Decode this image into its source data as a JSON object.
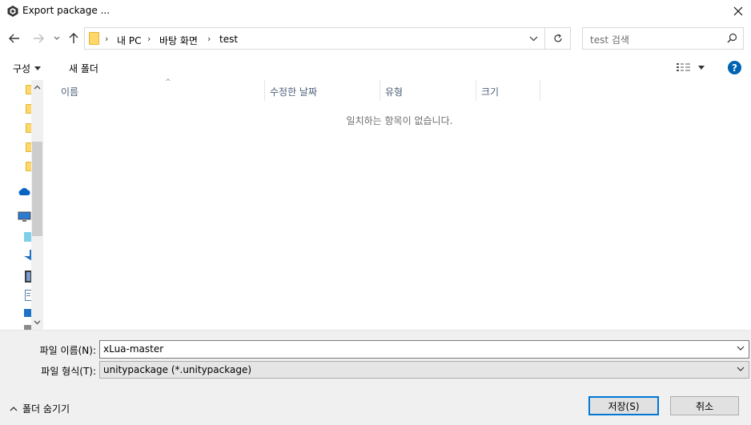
{
  "window": {
    "title": "Export package ..."
  },
  "address": {
    "crumbs": [
      "내 PC",
      "바탕 화면",
      "test"
    ]
  },
  "search": {
    "placeholder": "test 검색"
  },
  "toolbar": {
    "organize_label": "구성",
    "new_folder_label": "새 폴더",
    "help_label": "?"
  },
  "file_list": {
    "columns": [
      "이름",
      "수정한 날짜",
      "유형",
      "크기"
    ],
    "empty_message": "일치하는 항목이 없습니다."
  },
  "form": {
    "filename_label": "파일 이름(N):",
    "filename_value": "xLua-master",
    "filetype_label": "파일 형식(T):",
    "filetype_value": "unitypackage (*.unitypackage)"
  },
  "footer": {
    "hide_folders_label": "폴더 숨기기",
    "save_label": "저장(S)",
    "cancel_label": "취소"
  },
  "colors": {
    "accent": "#0078d7",
    "help_icon": "#0063b1",
    "selection": "#cce8ff",
    "folder": "#ffd869"
  }
}
